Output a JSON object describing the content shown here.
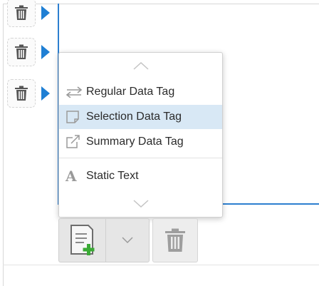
{
  "icons": {
    "row_delete": "trash-icon",
    "row_expand": "play-arrow-icon",
    "menu_scroll_up": "chevron-up-icon",
    "menu_scroll_down": "chevron-down-icon",
    "regular_tag": "swap-arrows-icon",
    "selection_tag": "square-icon",
    "summary_tag": "external-link-icon",
    "static_text": "letter-a-icon",
    "add_document": "document-add-icon",
    "split_caret": "chevron-down-icon",
    "delete": "trash-icon"
  },
  "dropdown": {
    "items": [
      {
        "label": "Regular Data Tag",
        "selected": false
      },
      {
        "label": "Selection Data Tag",
        "selected": true
      },
      {
        "label": "Summary Data Tag",
        "selected": false
      },
      {
        "label": "Static Text",
        "selected": false
      }
    ],
    "static_text_glyph": "A"
  },
  "colors": {
    "accent_blue": "#1f7fd4",
    "editor_border": "#2d7fd0",
    "selected_bg": "#d8e8f5",
    "add_plus_green": "#3aaa35",
    "icon_gray": "#8a8a8a"
  }
}
